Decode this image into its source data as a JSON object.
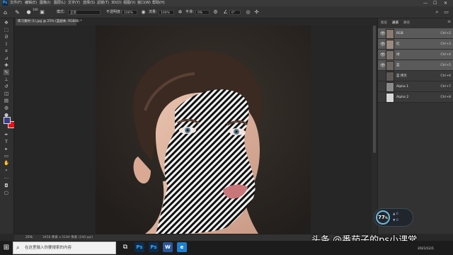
{
  "app": {
    "logo": "Ps"
  },
  "menubar": {
    "items": [
      "文件(F)",
      "编辑(E)",
      "图像(I)",
      "图层(L)",
      "文字(Y)",
      "选择(S)",
      "滤镜(T)",
      "3D(D)",
      "视图(V)",
      "窗口(W)",
      "帮助(H)"
    ],
    "window_controls": [
      "—",
      "☐",
      "✕"
    ]
  },
  "options": {
    "brush_size": "100",
    "mode_label": "模式：",
    "mode_value": "正常",
    "opacity_label": "不透明度：",
    "opacity_value": "100%",
    "flow_label": "流量：",
    "flow_value": "100%",
    "smoothing_label": "平滑：",
    "smoothing_value": "0%",
    "angle_value": "0°"
  },
  "document": {
    "tab_title": "练习素材 (1).jpg @ 25% (蓝副本, RGB/8) *"
  },
  "panel": {
    "tabs": [
      "图层",
      "通道",
      "路径"
    ],
    "active_tab": "通道",
    "channels": [
      {
        "name": "RGB",
        "shortcut": "Ctrl+2",
        "visible": true,
        "selected": true
      },
      {
        "name": "红",
        "shortcut": "Ctrl+3",
        "visible": true,
        "selected": true
      },
      {
        "name": "绿",
        "shortcut": "Ctrl+4",
        "visible": true,
        "selected": true
      },
      {
        "name": "蓝",
        "shortcut": "Ctrl+5",
        "visible": true,
        "selected": true
      },
      {
        "name": "蓝 拷贝",
        "shortcut": "Ctrl+6",
        "visible": false,
        "selected": false
      },
      {
        "name": "Alpha 1",
        "shortcut": "Ctrl+7",
        "visible": false,
        "selected": false
      },
      {
        "name": "Alpha 2",
        "shortcut": "Ctrl+8",
        "visible": false,
        "selected": false
      }
    ]
  },
  "performance": {
    "percent": "77",
    "unit": "%",
    "up": "0",
    "down": "0"
  },
  "statusbar": {
    "zoom": "25%",
    "doc_info": "3456 像素 x 5184 像素 (240 ppi)"
  },
  "taskbar": {
    "search_placeholder": "在这里输入你要搜索的内容",
    "apps": [
      "Ps",
      "Ps",
      "W",
      "e"
    ],
    "clock_date": "2021/12/1"
  },
  "watermark": "头条 @番茄子的ps小课堂",
  "colors": {
    "foreground": "#3d3b86",
    "background": "#ee1010"
  }
}
